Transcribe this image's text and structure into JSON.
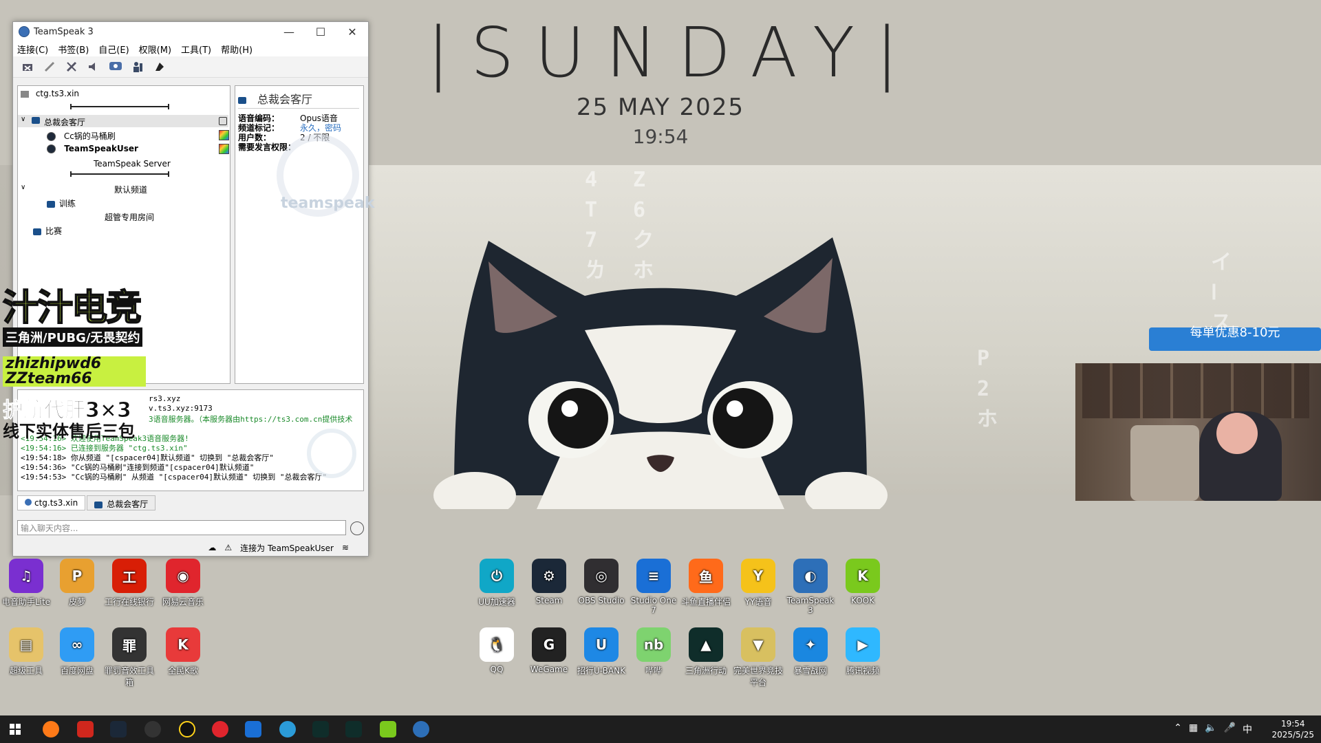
{
  "clock": {
    "day": "|SUNDAY|",
    "date": "25 MAY 2025",
    "time": "19:54"
  },
  "window": {
    "title": "TeamSpeak 3",
    "menu": [
      "连接(C)",
      "书签(B)",
      "自己(E)",
      "权限(M)",
      "工具(T)",
      "帮助(H)"
    ],
    "tree": {
      "server": "ctg.ts3.xin",
      "channel1": "总裁会客厅",
      "user1": "Cc锅的马桶刷",
      "user2": "TeamSpeakUser",
      "spacer_text": "TeamSpeak Server",
      "channel_default": "默认频道",
      "channel_train": "训练",
      "channel_super": "超管专用房间",
      "channel_match": "比赛"
    },
    "info": {
      "title": "总裁会客厅",
      "codec_label": "语音编码：",
      "codec_value": "Opus语音",
      "flags_label": "频道标记：",
      "flags_value": "永久，密码",
      "users_label": "用户数：",
      "users_value": "2 / 不限",
      "talk_label": "需要发言权限：",
      "logo_text": "teamspeak"
    },
    "chat": [
      "rs3.xyz",
      "v.ts3.xyz:9173",
      "3语音服务器。（本服务器由https://ts3.com.cn提供技术",
      "<19:54:16> 欢迎使用TeamSpeak3语音服务器!",
      "<19:54:16> 已连接到服务器 \"ctg.ts3.xin\"",
      "<19:54:18> 你从频道 \"[cspacer04]默认频道\" 切换到 \"总裁会客厅\"",
      "<19:54:36> \"Cc锅的马桶刷\"连接到频道\"[cspacer04]默认频道\"",
      "<19:54:53> \"Cc锅的马桶刷\" 从频道 \"[cspacer04]默认频道\" 切换到 \"总裁会客厅\""
    ],
    "tabs": [
      "ctg.ts3.xin",
      "总裁会客厅"
    ],
    "input_placeholder": "输入聊天内容...",
    "status": "连接为 TeamSpeakUser"
  },
  "promo": {
    "title": "汁汁电竞",
    "games": "三角洲/PUBG/无畏契约",
    "wechat1": "zhizhipwd6",
    "wechat2": "ZZteam66",
    "line1": "护航代肝3×3",
    "line2": "线下实体售后三包"
  },
  "banner": {
    "text": "每单优惠8-10元"
  },
  "desktop_left": [
    {
      "label": "电音助手Lite",
      "color": "#7a2fd0",
      "glyph": "♫"
    },
    {
      "label": "皮萝",
      "color": "#e8a030",
      "glyph": "P"
    },
    {
      "label": "工行在线银行",
      "color": "#d81e06",
      "glyph": "工"
    },
    {
      "label": "网易云音乐",
      "color": "#e0252d",
      "glyph": "◉"
    },
    {
      "label": "超级工具",
      "color": "#e6c36a",
      "glyph": "▤"
    },
    {
      "label": "百度网盘",
      "color": "#2f9cf4",
      "glyph": "∞"
    },
    {
      "label": "罪罚音效工具箱",
      "color": "#333333",
      "glyph": "罪"
    },
    {
      "label": "全民K歌",
      "color": "#e83a3a",
      "glyph": "K"
    }
  ],
  "desktop_right": [
    {
      "label": "UU加速器",
      "color": "#10a7c7",
      "glyph": "⏻"
    },
    {
      "label": "Steam",
      "color": "#1b2838",
      "glyph": "⚙"
    },
    {
      "label": "OBS Studio",
      "color": "#302e31",
      "glyph": "◎"
    },
    {
      "label": "Studio One 7",
      "color": "#1a6fd6",
      "glyph": "≡"
    },
    {
      "label": "斗鱼直播伴侣",
      "color": "#ff6a1a",
      "glyph": "鱼"
    },
    {
      "label": "YY语音",
      "color": "#f5c21a",
      "glyph": "Y"
    },
    {
      "label": "TeamSpeak 3",
      "color": "#2d6fb8",
      "glyph": "◐"
    },
    {
      "label": "KOOK",
      "color": "#7ac91d",
      "glyph": "K"
    },
    {
      "label": "QQ",
      "color": "#ffffff",
      "glyph": "🐧"
    },
    {
      "label": "WeGame",
      "color": "#222222",
      "glyph": "G"
    },
    {
      "label": "招行U-BANK",
      "color": "#1e88e5",
      "glyph": "U"
    },
    {
      "label": "哔哔",
      "color": "#7ed36f",
      "glyph": "nb"
    },
    {
      "label": "三角洲行动",
      "color": "#0f2d2a",
      "glyph": "▲"
    },
    {
      "label": "完美世界竞技平台",
      "color": "#d8c060",
      "glyph": "▼"
    },
    {
      "label": "暴雪战网",
      "color": "#1a87e0",
      "glyph": "✦"
    },
    {
      "label": "腾讯视频",
      "color": "#2fb8ff",
      "glyph": "▶"
    }
  ],
  "tray": {
    "time": "19:54",
    "date": "2025/5/25",
    "ime": "中"
  },
  "colors": {
    "accent": "#2d6fb8",
    "promo_green": "#c8f040",
    "taskbar": "#1e1e1e"
  }
}
